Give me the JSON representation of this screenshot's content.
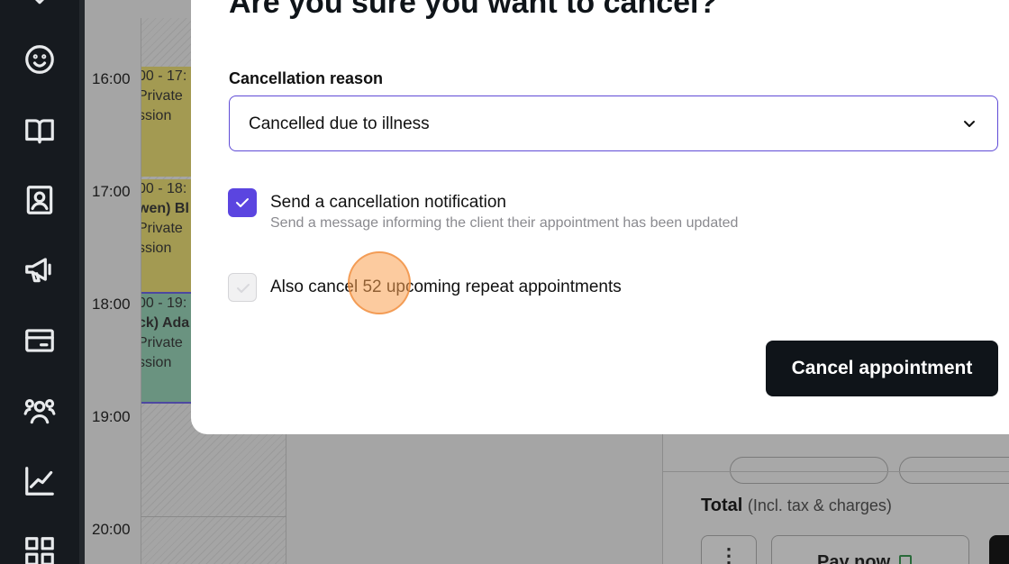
{
  "sidebar": {
    "icons": [
      "chevron-icon",
      "smiley-icon",
      "book-icon",
      "contact-card-icon",
      "megaphone-icon",
      "credit-card-icon",
      "team-icon",
      "chart-line-icon",
      "grid-icon"
    ]
  },
  "calendar": {
    "times": [
      "16:00",
      "17:00",
      "18:00",
      "19:00",
      "20:00"
    ],
    "events": [
      {
        "time": "00 - 17:",
        "name": "",
        "type": "Private",
        "session": "ssion",
        "color": "#a39a52"
      },
      {
        "time": "00 - 18:",
        "name": "wen) Bl",
        "type": "Private",
        "session": "ssion",
        "color": "#a39a52"
      },
      {
        "time": "00 - 19:",
        "name": "ck) Ada",
        "type": "Private",
        "session": "ssion",
        "color": "#6a9380"
      }
    ]
  },
  "checkout": {
    "total_label": "Total",
    "total_note": "(Incl. tax & charges)",
    "more_label": "⋮",
    "pay_now_label": "Pay now"
  },
  "modal": {
    "title": "Are you sure you want to cancel?",
    "reason_label": "Cancellation reason",
    "reason_value": "Cancelled due to illness",
    "notify_label": "Send a cancellation notification",
    "notify_desc": "Send a message informing the client their appointment has been updated",
    "notify_checked": true,
    "repeat_label": "Also cancel 52 upcoming repeat appointments",
    "repeat_checked": false,
    "confirm_label": "Cancel appointment",
    "accent_color": "#5b45e0"
  }
}
